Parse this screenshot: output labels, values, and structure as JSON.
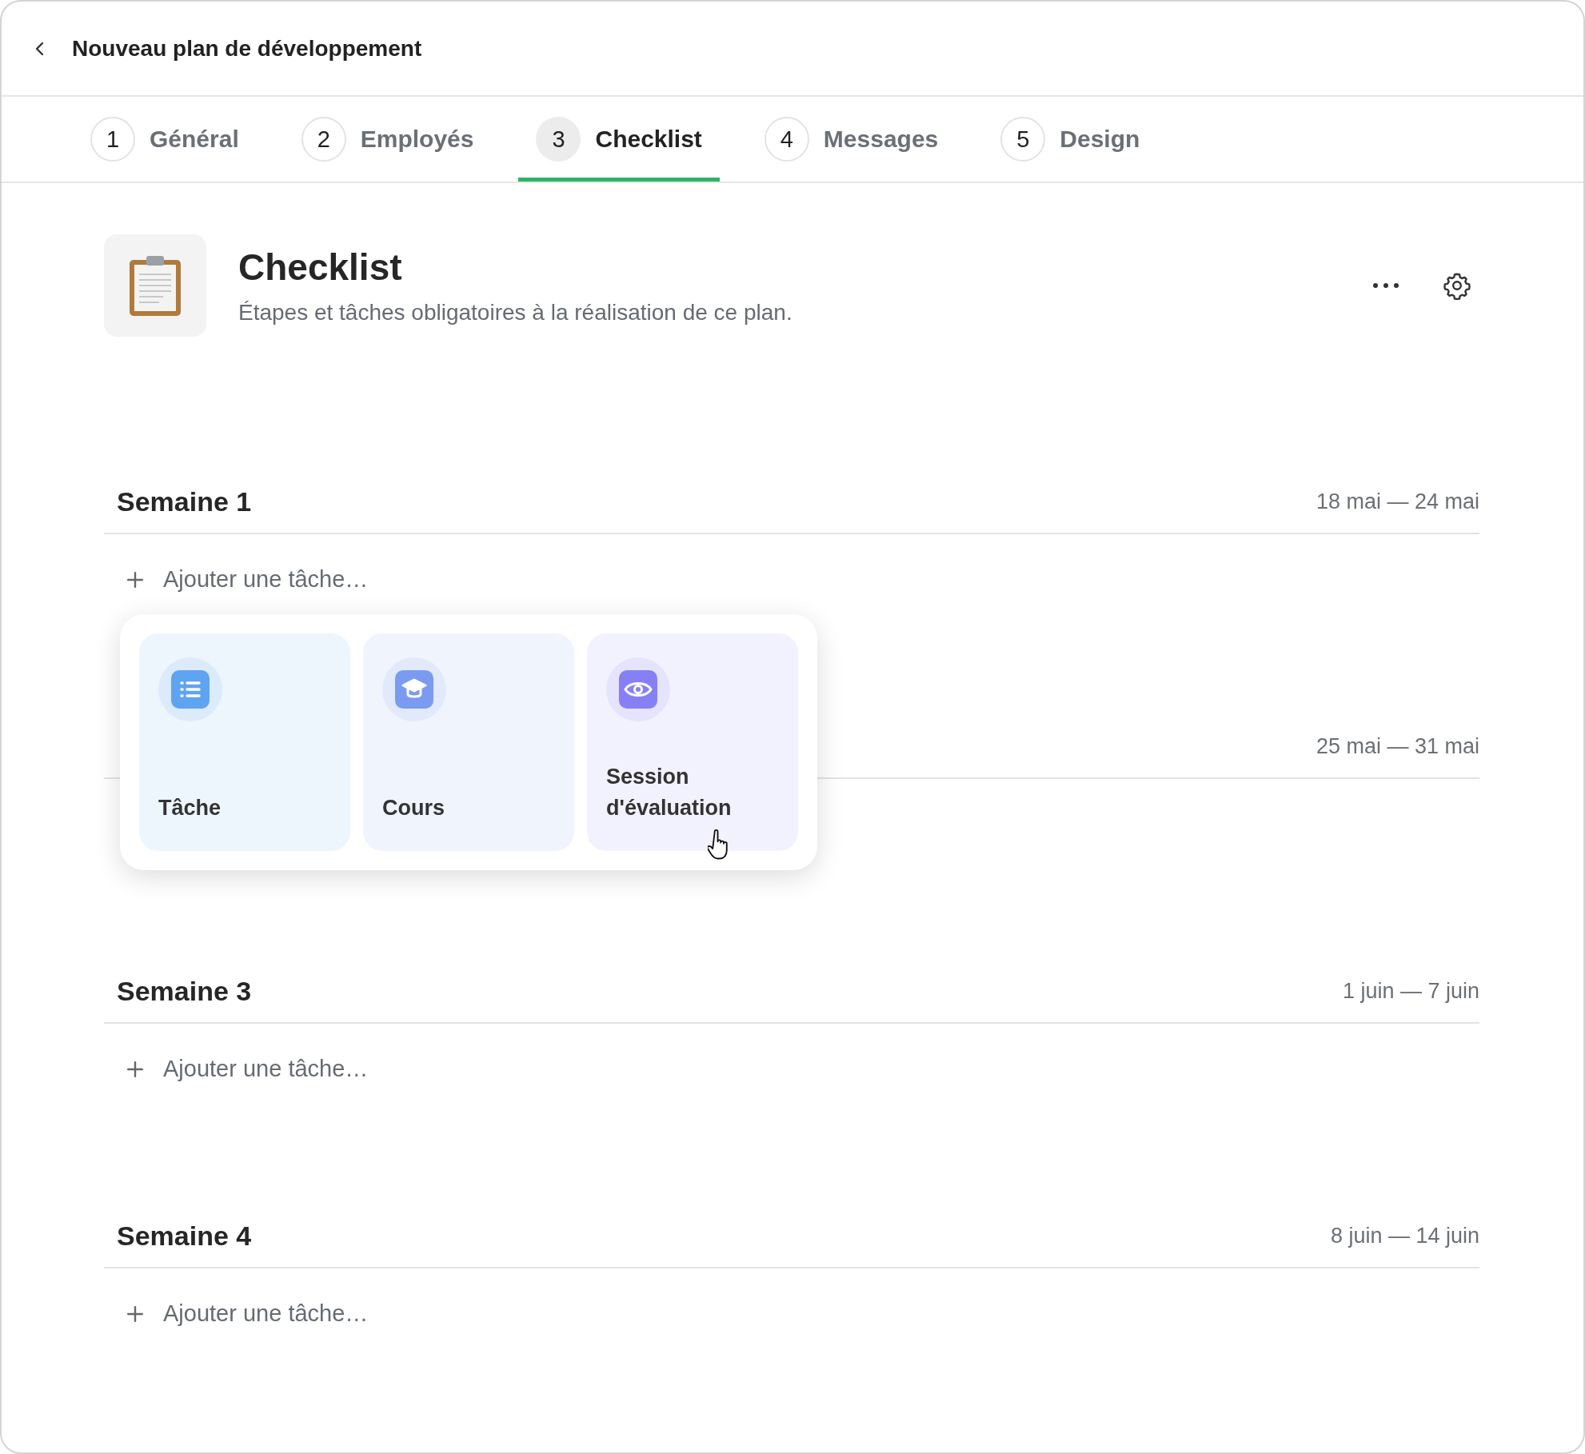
{
  "header": {
    "title": "Nouveau plan de développement"
  },
  "tabs": [
    {
      "number": "1",
      "label": "Général",
      "selected": false
    },
    {
      "number": "2",
      "label": "Employés",
      "selected": false
    },
    {
      "number": "3",
      "label": "Checklist",
      "selected": true
    },
    {
      "number": "4",
      "label": "Messages",
      "selected": false
    },
    {
      "number": "5",
      "label": "Design",
      "selected": false
    }
  ],
  "section": {
    "title": "Checklist",
    "subtitle": "Étapes et tâches obligatoires à la réalisation de ce plan."
  },
  "weeks": [
    {
      "title": "Semaine 1",
      "dates": "18 mai — 24 mai",
      "add_label": "Ajouter une tâche…",
      "add_menu": {
        "items": [
          {
            "kind": "task",
            "label": "Tâche",
            "color": "#5fa4f0"
          },
          {
            "kind": "course",
            "label": "Cours",
            "color": "#7b9bf0"
          },
          {
            "kind": "review",
            "label": "Session d'évaluation",
            "color": "#8780f5"
          }
        ]
      }
    },
    {
      "dates": "25 mai — 31 mai"
    },
    {
      "title": "Semaine 3",
      "dates": "1 juin — 7 juin",
      "add_label": "Ajouter une tâche…"
    },
    {
      "title": "Semaine 4",
      "dates": "8 juin — 14 juin",
      "add_label": "Ajouter une tâche…"
    }
  ]
}
